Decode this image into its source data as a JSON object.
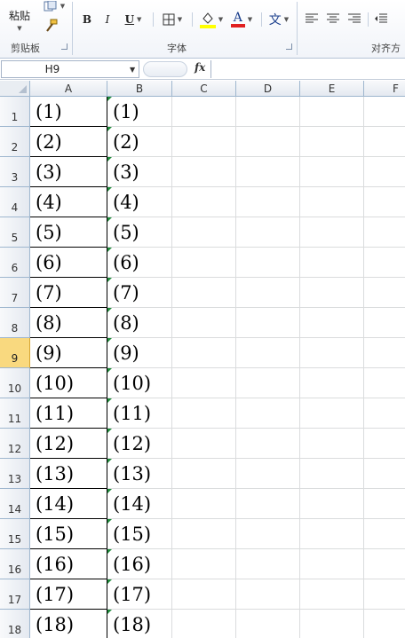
{
  "ribbon": {
    "paste_label": "粘贴",
    "clipboard_group": "剪贴板",
    "font_group": "字体",
    "align_group": "对齐方",
    "bold": "B",
    "italic": "I",
    "underline": "U",
    "font_color_glyph": "A",
    "wen_glyph": "文"
  },
  "formula_bar": {
    "name_box": "H9",
    "fx": "fx",
    "formula": ""
  },
  "sheet": {
    "columns": [
      "A",
      "B",
      "C",
      "D",
      "E",
      "F"
    ],
    "rows": [
      "1",
      "2",
      "3",
      "4",
      "5",
      "6",
      "7",
      "8",
      "9",
      "10",
      "11",
      "12",
      "13",
      "14",
      "15",
      "16",
      "17",
      "18"
    ],
    "active_row": "9",
    "col_a": [
      "(1)",
      "(2)",
      "(3)",
      "(4)",
      "(5)",
      "(6)",
      "(7)",
      "(8)",
      "(9)",
      "(10)",
      "(11)",
      "(12)",
      "(13)",
      "(14)",
      "(15)",
      "(16)",
      "(17)",
      "(18)"
    ],
    "col_b": [
      "(1)",
      "(2)",
      "(3)",
      "(4)",
      "(5)",
      "(6)",
      "(7)",
      "(8)",
      "(9)",
      "(10)",
      "(11)",
      "(12)",
      "(13)",
      "(14)",
      "(15)",
      "(16)",
      "(17)",
      "(18)"
    ]
  },
  "colors": {
    "accent_highlight": "#f9d97f",
    "fill_color_bar": "#ffff00",
    "font_color_bar": "#e02020",
    "error_indicator": "#1f8a3a"
  }
}
